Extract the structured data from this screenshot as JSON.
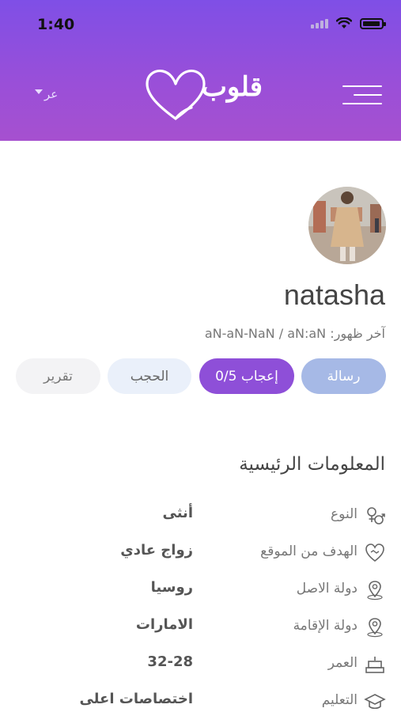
{
  "status_bar": {
    "time": "1:40"
  },
  "header": {
    "language": "عر",
    "logo_text": "قلوب",
    "colors": {
      "gradient_top": "#7f4fe6",
      "gradient_bottom": "#a650cf"
    }
  },
  "profile": {
    "name": "natasha",
    "last_seen_label": "آخر ظهور:",
    "last_seen_value": "aN-aN-NaN / aN:aN"
  },
  "actions": {
    "message": "رسالة",
    "like": "إعجاب 0/5",
    "block": "الحجب",
    "report": "تقرير"
  },
  "main_info": {
    "title": "المعلومات الرئيسية",
    "rows": [
      {
        "icon": "gender-icon",
        "label": "النوع",
        "value": "أنثى"
      },
      {
        "icon": "goal-icon",
        "label": "الهدف من الموقع",
        "value": "زواج عادي"
      },
      {
        "icon": "location-pin-icon",
        "label": "دولة الاصل",
        "value": "روسيا"
      },
      {
        "icon": "location-pin-icon",
        "label": "دولة الإقامة",
        "value": "الامارات"
      },
      {
        "icon": "cake-icon",
        "label": "العمر",
        "value": "32-28"
      },
      {
        "icon": "graduation-cap-icon",
        "label": "التعليم",
        "value": "اختصاصات اعلى"
      }
    ]
  }
}
